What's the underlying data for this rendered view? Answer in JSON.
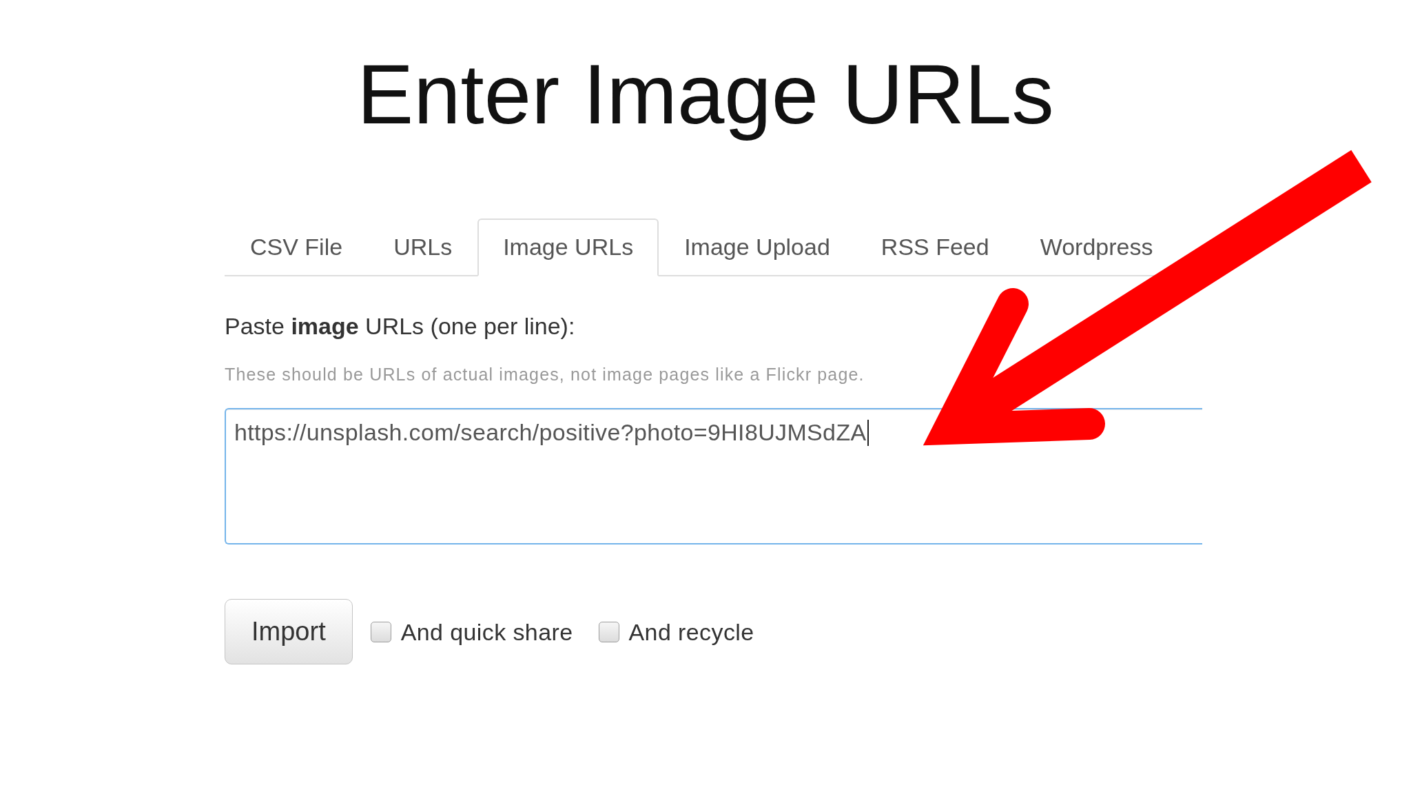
{
  "title": "Enter Image URLs",
  "tabs": [
    {
      "label": "CSV File",
      "selected": false
    },
    {
      "label": "URLs",
      "selected": false
    },
    {
      "label": "Image URLs",
      "selected": true
    },
    {
      "label": "Image Upload",
      "selected": false
    },
    {
      "label": "RSS Feed",
      "selected": false
    },
    {
      "label": "Wordpress",
      "selected": false
    }
  ],
  "form": {
    "label": "Paste **image** URLs (one per line):",
    "help_text": "These should be URLs of actual images, not image pages like a Flickr page.",
    "urls_field": {
      "value": "https://unsplash.com/search/positive?photo=9HI8UJMSdZA",
      "focused": true
    },
    "import_button": "Import",
    "options": [
      {
        "label": "And quick share",
        "checked": false
      },
      {
        "label": "And recycle",
        "checked": false
      }
    ]
  },
  "callout": {
    "kind": "arrow"
  }
}
